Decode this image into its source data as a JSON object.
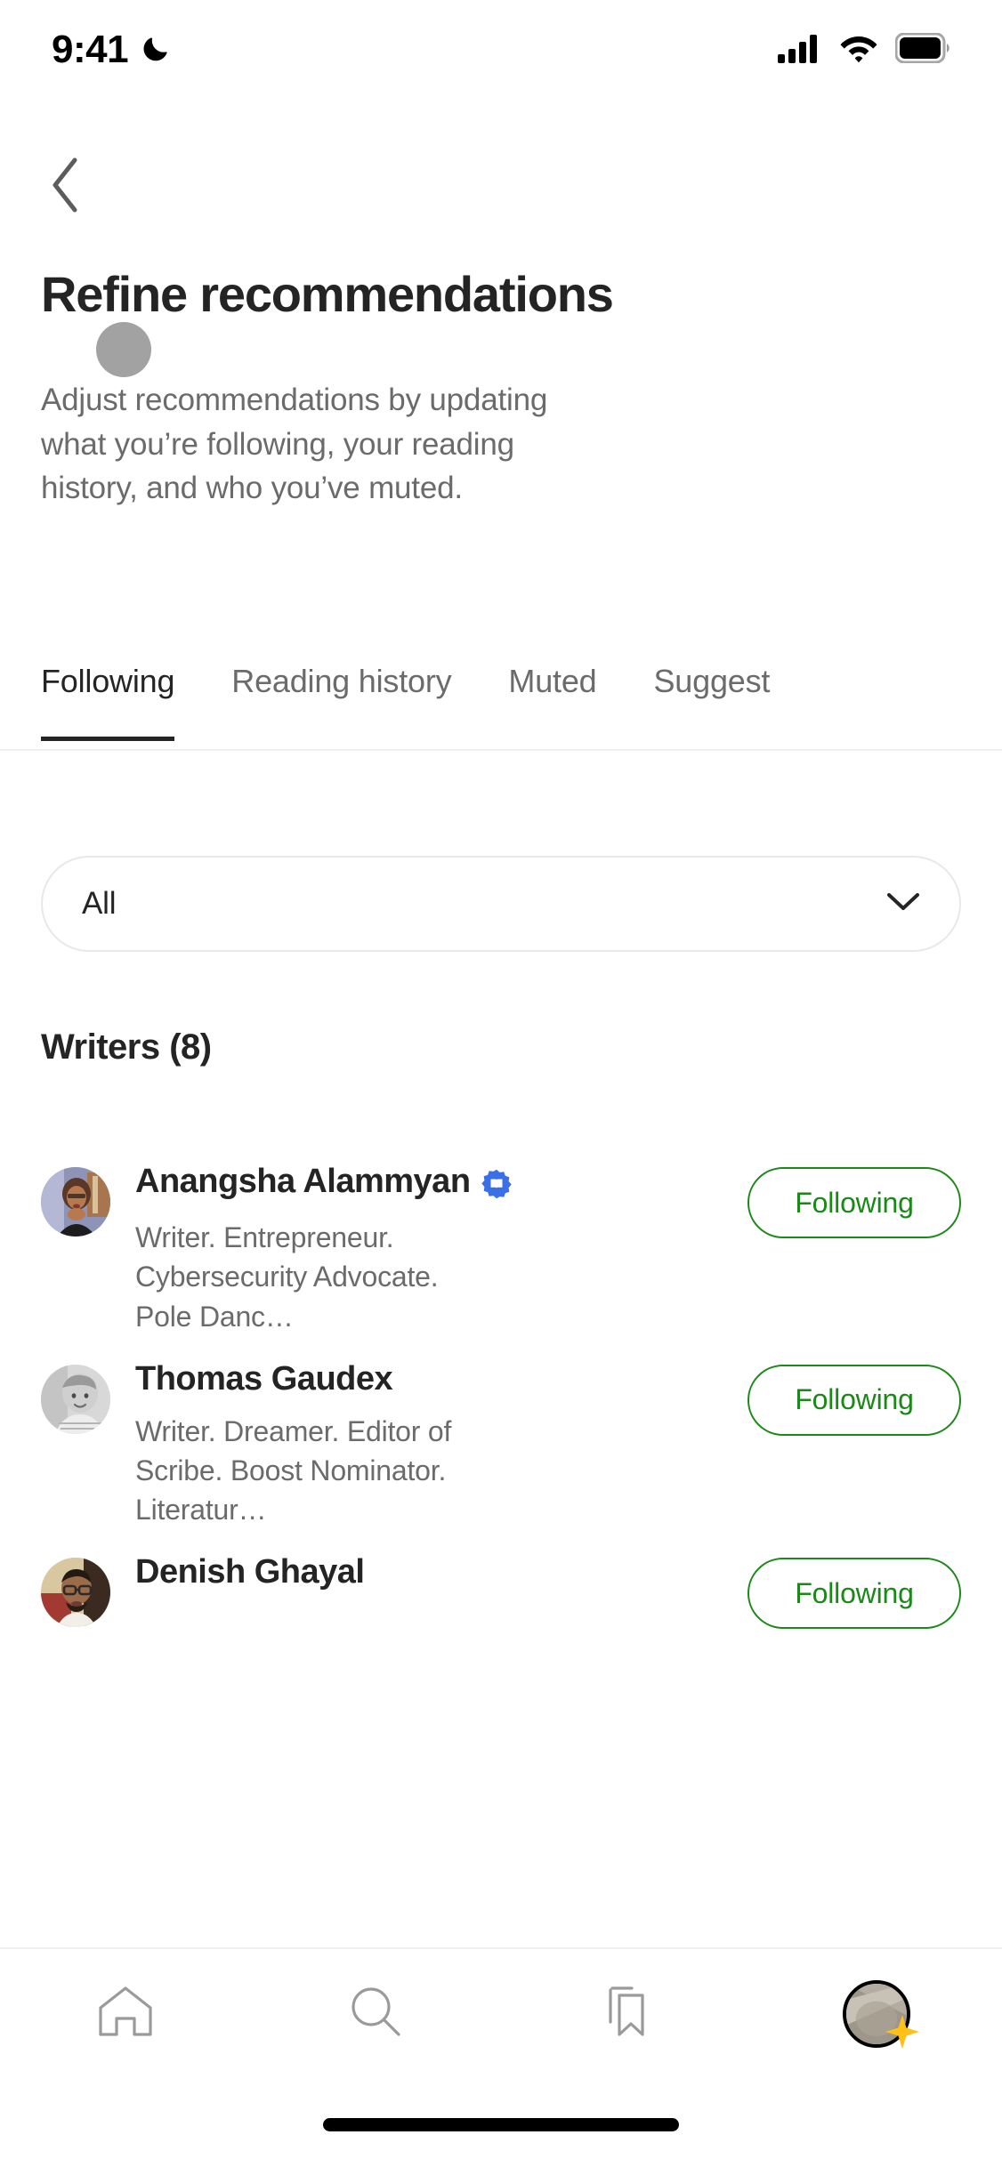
{
  "status_bar": {
    "time": "9:41",
    "dnd_icon": "crescent-moon-icon",
    "cellular_icon": "cellular-bars-icon",
    "wifi_icon": "wifi-icon",
    "battery_icon": "battery-full-icon"
  },
  "nav": {
    "back_icon": "chevron-left-icon"
  },
  "header": {
    "title": "Refine recommendations",
    "description": "Adjust recommendations by updating what you’re following, your reading history, and who you’ve muted."
  },
  "tabs": [
    {
      "label": "Following",
      "active": true
    },
    {
      "label": "Reading history",
      "active": false
    },
    {
      "label": "Muted",
      "active": false
    },
    {
      "label": "Suggest",
      "active": false
    }
  ],
  "filter": {
    "selected": "All",
    "chevron_icon": "chevron-down-icon"
  },
  "section": {
    "writers_heading": "Writers (8)"
  },
  "writers": [
    {
      "name": "Anangsha Alammyan",
      "verified": true,
      "verified_icon": "verified-book-badge-icon",
      "bio": "Writer. Entrepreneur. Cybersecurity Advocate. Pole Danc…",
      "button_label": "Following"
    },
    {
      "name": "Thomas Gaudex",
      "verified": false,
      "bio": "Writer. Dreamer. Editor of Scribe. Boost Nominator. Literatur…",
      "button_label": "Following"
    },
    {
      "name": "Denish Ghayal",
      "verified": false,
      "bio": "",
      "button_label": "Following"
    }
  ],
  "bottom_nav": [
    {
      "icon": "home-icon",
      "label": "Home"
    },
    {
      "icon": "search-icon",
      "label": "Search"
    },
    {
      "icon": "bookmark-icon",
      "label": "Bookmarks"
    },
    {
      "icon": "profile-avatar-icon",
      "label": "Profile",
      "badge_icon": "sparkle-icon"
    }
  ],
  "colors": {
    "accent_green": "#1a8917",
    "verified_blue": "#3b6fe8",
    "text_primary": "#242424",
    "text_secondary": "#6b6b6b",
    "sparkle_yellow": "#ffc017",
    "touch_indicator": "#9e9e9e"
  }
}
